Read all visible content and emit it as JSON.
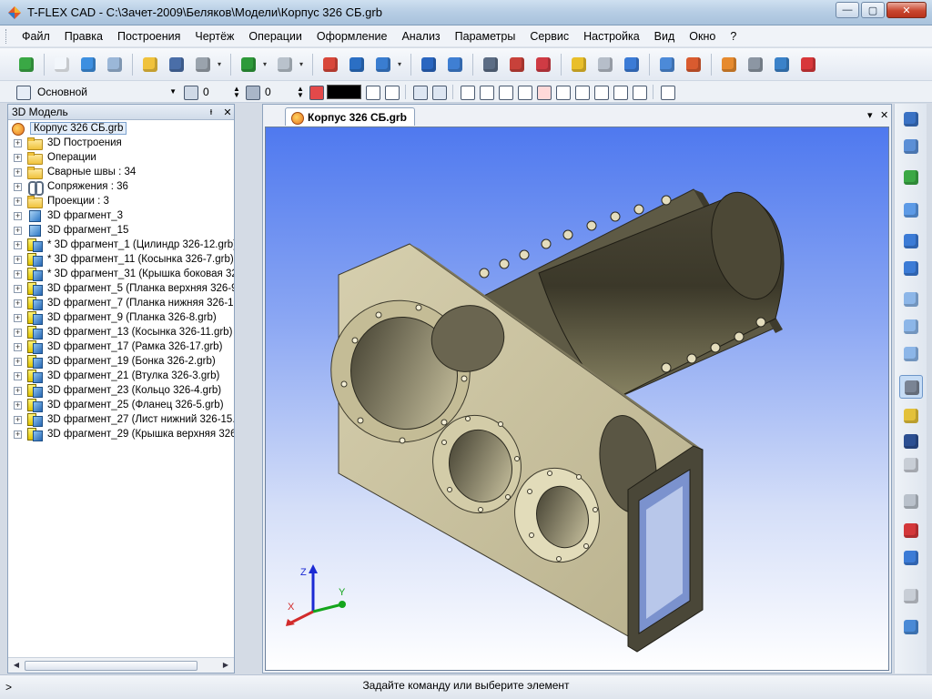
{
  "window": {
    "title": "T-FLEX CAD - C:\\Зачет-2009\\Беляков\\Модели\\Корпус 326 СБ.grb",
    "minimize": "—",
    "maximize": "▢",
    "close": "✕"
  },
  "menu": [
    "Файл",
    "Правка",
    "Построения",
    "Чертёж",
    "Операции",
    "Оформление",
    "Анализ",
    "Параметры",
    "Сервис",
    "Настройка",
    "Вид",
    "Окно",
    "?"
  ],
  "toolbar2": {
    "layer": "Основной",
    "level_value": "0",
    "priority_value": "0",
    "color": "#000000"
  },
  "panel": {
    "title": "3D Модель",
    "pin": "ᵻ",
    "close": "✕",
    "root": "Корпус 326 СБ.grb",
    "items": [
      {
        "label": "3D Построения",
        "icon": "folder-icon"
      },
      {
        "label": "Операции",
        "icon": "folder-icon"
      },
      {
        "label": "Сварные швы : 34",
        "icon": "folder-icon"
      },
      {
        "label": "Сопряжения : 36",
        "icon": "mate-icon"
      },
      {
        "label": "Проекции : 3",
        "icon": "folder-icon"
      },
      {
        "label": "3D фрагмент_3",
        "icon": "cube-icon"
      },
      {
        "label": "3D фрагмент_15",
        "icon": "cube-icon"
      },
      {
        "label": "* 3D фрагмент_1 (Цилиндр 326-12.grb)",
        "icon": "fragment-icon"
      },
      {
        "label": "* 3D фрагмент_11 (Косынка 326-7.grb)",
        "icon": "fragment-icon"
      },
      {
        "label": "* 3D фрагмент_31 (Крышка боковая 326",
        "icon": "fragment-icon"
      },
      {
        "label": "3D фрагмент_5 (Планка верхняя 326-9.g",
        "icon": "fragment-icon"
      },
      {
        "label": "3D фрагмент_7 (Планка нижняя 326-10.g",
        "icon": "fragment-icon"
      },
      {
        "label": "3D фрагмент_9 (Планка 326-8.grb)",
        "icon": "fragment-icon"
      },
      {
        "label": "3D фрагмент_13 (Косынка 326-11.grb)",
        "icon": "fragment-icon"
      },
      {
        "label": "3D фрагмент_17 (Рамка 326-17.grb)",
        "icon": "fragment-icon"
      },
      {
        "label": "3D фрагмент_19 (Бонка 326-2.grb)",
        "icon": "fragment-icon"
      },
      {
        "label": "3D фрагмент_21 (Втулка 326-3.grb)",
        "icon": "fragment-icon"
      },
      {
        "label": "3D фрагмент_23 (Кольцо 326-4.grb)",
        "icon": "fragment-icon"
      },
      {
        "label": "3D фрагмент_25 (Фланец 326-5.grb)",
        "icon": "fragment-icon"
      },
      {
        "label": "3D фрагмент_27 (Лист нижний 326-15.gr",
        "icon": "fragment-icon"
      },
      {
        "label": "3D фрагмент_29 (Крышка верхняя 326-1",
        "icon": "fragment-icon"
      }
    ]
  },
  "document": {
    "tab": "Корпус 326 СБ.grb",
    "tab_menu": "▾",
    "tab_close": "✕"
  },
  "axes": {
    "x": "X",
    "y": "Y",
    "z": "Z"
  },
  "status": {
    "prompt": ">",
    "message": "Задайте команду или выберите элемент"
  }
}
